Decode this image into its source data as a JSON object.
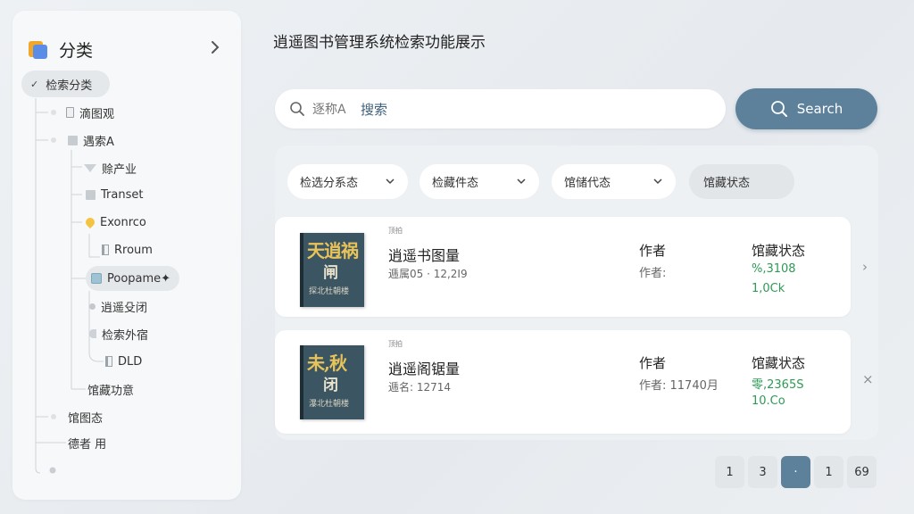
{
  "sidebar": {
    "title": "分类",
    "root_label": "检索分类",
    "items": [
      {
        "label": "滴图观",
        "icon": "document-icon"
      },
      {
        "label": "遇索A",
        "icon": "square-icon"
      },
      {
        "label": "赊产业",
        "icon": "triangle-icon"
      },
      {
        "label": "Transet",
        "icon": "square-icon"
      },
      {
        "label": "Exonrco",
        "icon": "heart-icon"
      },
      {
        "label": "Rroum",
        "icon": "tab-icon"
      },
      {
        "label": "Poopame✦",
        "icon": "teal-square-icon"
      },
      {
        "label": "逍遥殳闭",
        "icon": "dot-icon"
      },
      {
        "label": "检索外宿",
        "icon": "half-circle-icon"
      },
      {
        "label": "DLD",
        "icon": "tab-icon"
      },
      {
        "label": "馆藏功意",
        "icon": ""
      },
      {
        "label": "馆图态",
        "icon": ""
      },
      {
        "label": "德者 用",
        "icon": ""
      }
    ]
  },
  "header": {
    "title": "逍遥图书管理系统检索功能展示"
  },
  "search": {
    "value": "逐称A",
    "accent_text": "搜索",
    "button_label": "Search",
    "icon": "search-icon"
  },
  "filters": [
    {
      "label": "检选分系态"
    },
    {
      "label": "检藏件态"
    },
    {
      "label": "馆储代态"
    },
    {
      "label": "馆藏状态"
    }
  ],
  "results": [
    {
      "cover_big": "天逍祸",
      "cover_mid": "闸",
      "cover_small": "探北杜朝楼",
      "tiny_label": "顶拍",
      "title": "逍遥书图量",
      "meta": "逓属05 · 12,2I9",
      "author_head": "作者",
      "author_value": "作者:",
      "status_head": "馆藏状态",
      "status_line1": "%,3108",
      "status_line2": "1,0Ck",
      "action": "›",
      "action_icon": "chevron-right-icon"
    },
    {
      "cover_big": "未,秋",
      "cover_mid": "闭",
      "cover_small": "瀑北杜朝楼",
      "tiny_label": "顶拍",
      "title": "逍遥阁锯量",
      "meta": "逓名: 12714",
      "author_head": "作者",
      "author_value": "作者: 11740月",
      "status_head": "馆藏状态",
      "status_line1": "零,2365S",
      "status_line2": "10.Co",
      "action": "×",
      "action_icon": "close-icon"
    }
  ],
  "pagination": [
    {
      "label": "1",
      "active": false
    },
    {
      "label": "3",
      "active": false
    },
    {
      "label": "·",
      "active": true
    },
    {
      "label": "1",
      "active": false
    },
    {
      "label": "69",
      "active": false
    }
  ],
  "colors": {
    "accent": "#5e819b",
    "status_green": "#2e9a55",
    "folder_orange": "#f1a72b",
    "folder_blue": "#5b8de6"
  }
}
